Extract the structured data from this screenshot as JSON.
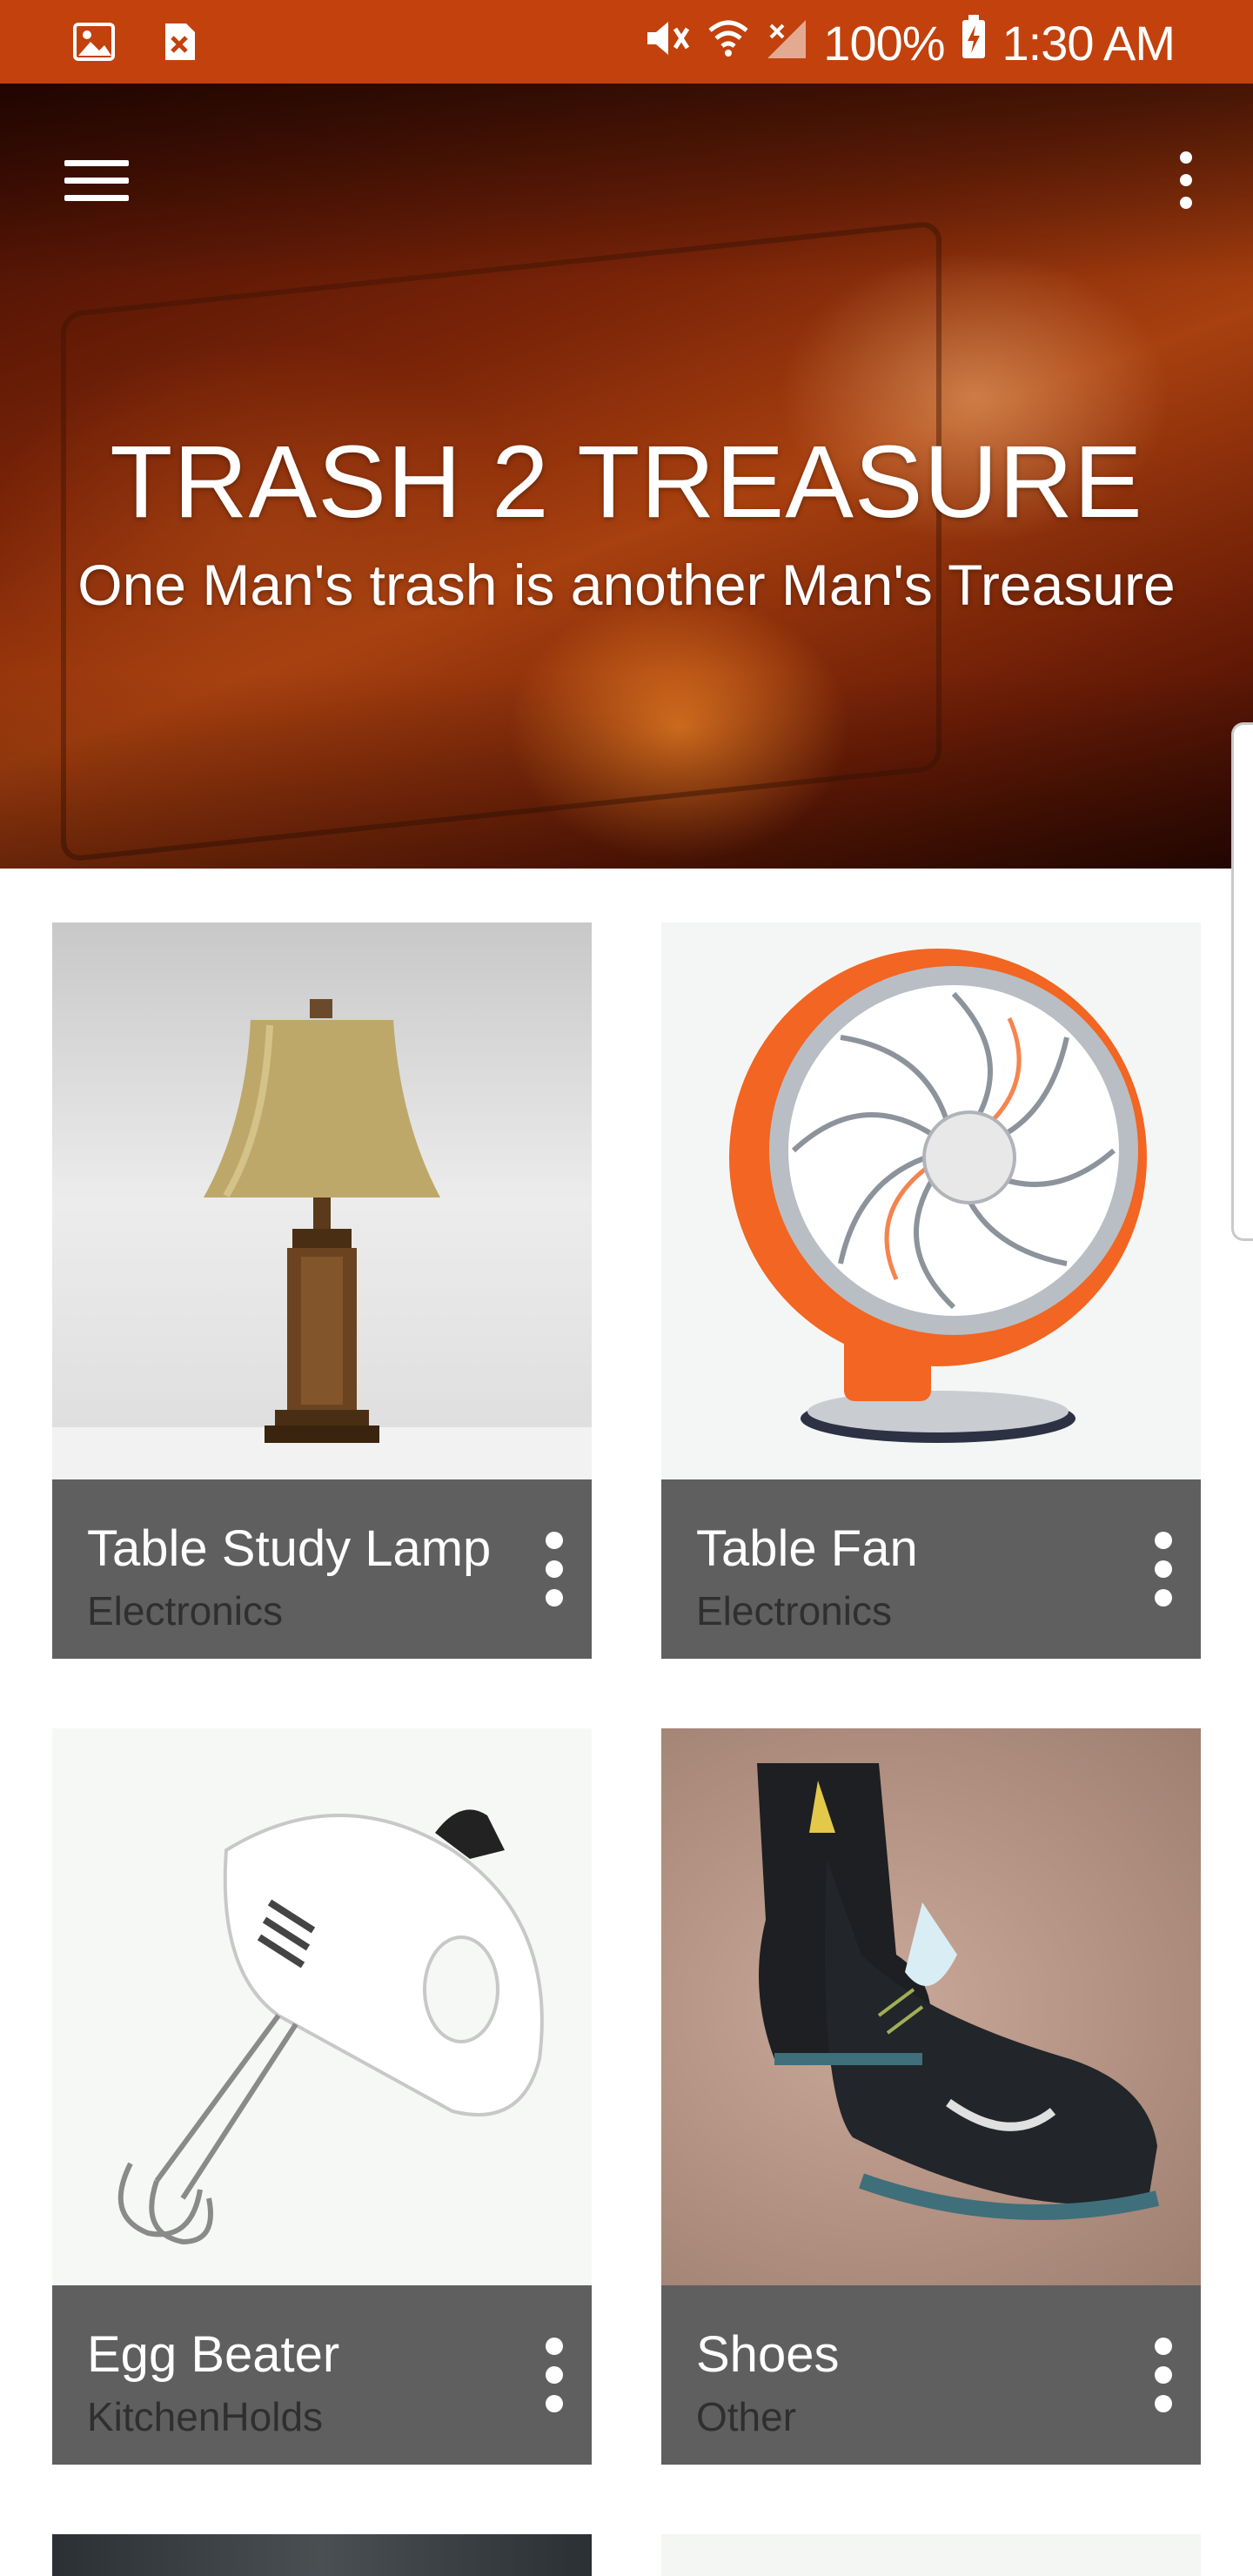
{
  "status_bar": {
    "left_icons": [
      "image-notification-icon",
      "blocked-notification-icon"
    ],
    "right_icons": [
      "mute-icon",
      "wifi-icon",
      "signal-icon",
      "battery-charging-icon"
    ],
    "battery": "100%",
    "time": "1:30 AM"
  },
  "header": {
    "title": "TRASH 2 TREASURE",
    "subtitle": "One Man's trash is another Man's Treasure",
    "background_color": "#7a2408"
  },
  "theme": {
    "status_bar_color": "#c2410c",
    "card_footer_color": "#5f5f5f"
  },
  "items": [
    {
      "title": "Table Study Lamp",
      "category": "Electronics",
      "image": "table-lamp"
    },
    {
      "title": "Table Fan",
      "category": "Electronics",
      "image": "table-fan"
    },
    {
      "title": "Egg Beater",
      "category": "KitchenHolds",
      "image": "hand-mixer"
    },
    {
      "title": "Shoes",
      "category": "Other",
      "image": "sneakers"
    }
  ]
}
